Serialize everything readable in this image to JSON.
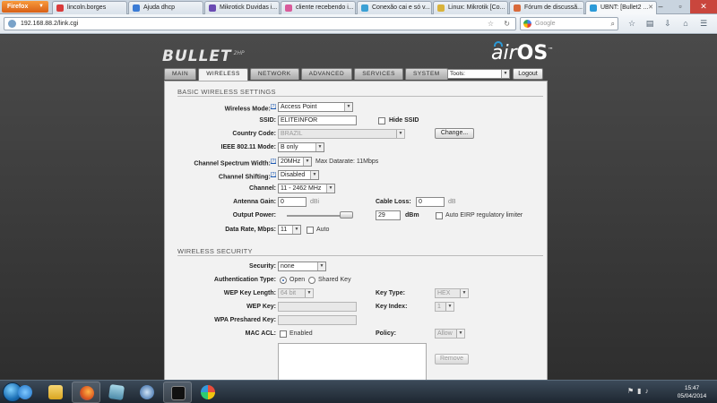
{
  "browser": {
    "menu_button": "Firefox",
    "tabs": [
      {
        "title": "lincoln.borges",
        "favicon_color": "#d93b3b"
      },
      {
        "title": "Ajuda dhcp",
        "favicon_color": "#3a7bd5"
      },
      {
        "title": "Mikrotick Duvidas i...",
        "favicon_color": "#6a4bb3"
      },
      {
        "title": "cliente recebendo i...",
        "favicon_color": "#d95b9b"
      },
      {
        "title": "Conexão cai e só v...",
        "favicon_color": "#3aa0d5"
      },
      {
        "title": "Linux: Mikrotik [Co...",
        "favicon_color": "#d9b33b"
      },
      {
        "title": "Fórum de discussã...",
        "favicon_color": "#d96a3b"
      },
      {
        "title": "UBNT: [Bullet2 ...",
        "favicon_color": "#2b9ad8"
      }
    ],
    "url": "192.168.88.2/link.cgi",
    "search_placeholder": "Google"
  },
  "header": {
    "product_logo": "BULLET",
    "product_logo_sub": "2HP",
    "brand_air": "air",
    "brand_os": "OS",
    "brand_tm": "™",
    "tabs": [
      "MAIN",
      "WIRELESS",
      "NETWORK",
      "ADVANCED",
      "SERVICES",
      "SYSTEM"
    ],
    "tools_label": "Tools:",
    "logout_label": "Logout"
  },
  "basic": {
    "title": "BASIC WIRELESS SETTINGS",
    "wireless_mode_label": "Wireless Mode:",
    "wireless_mode_value": "Access Point",
    "ssid_label": "SSID:",
    "ssid_value": "ELITEINFOR",
    "hide_ssid_label": "Hide SSID",
    "country_label": "Country Code:",
    "country_value": "BRAZIL",
    "change_label": "Change...",
    "ieee_label": "IEEE 802.11 Mode:",
    "ieee_value": "B only",
    "width_label": "Channel Spectrum Width:",
    "width_value": "20MHz",
    "max_datarate": "Max Datarate: 11Mbps",
    "shifting_label": "Channel Shifting:",
    "shifting_value": "Disabled",
    "channel_label": "Channel:",
    "channel_value": "11 - 2462 MHz",
    "antenna_gain_label": "Antenna Gain:",
    "antenna_gain_value": "0",
    "antenna_gain_unit": "dBi",
    "cable_loss_label": "Cable Loss:",
    "cable_loss_value": "0",
    "cable_loss_unit": "dB",
    "output_power_label": "Output Power:",
    "output_power_value": "29",
    "output_power_unit": "dBm",
    "output_power_fraction": 1.0,
    "auto_eirp_label": "Auto EIRP regulatory limiter",
    "data_rate_label": "Data Rate, Mbps:",
    "data_rate_value": "11",
    "data_rate_auto": "Auto",
    "help_mark": "[?]"
  },
  "security": {
    "title": "WIRELESS SECURITY",
    "security_label": "Security:",
    "security_value": "none",
    "auth_label": "Authentication Type:",
    "auth_open": "Open",
    "auth_shared": "Shared Key",
    "wep_len_label": "WEP Key Length:",
    "wep_len_value": "64 bit",
    "key_type_label": "Key Type:",
    "key_type_value": "HEX",
    "wep_key_label": "WEP Key:",
    "key_index_label": "Key Index:",
    "key_index_value": "1",
    "wpa_label": "WPA Preshared Key:",
    "mac_acl_label": "MAC ACL:",
    "mac_acl_enabled": "Enabled",
    "policy_label": "Policy:",
    "policy_value": "Allow",
    "remove_label": "Remove"
  },
  "taskbar": {
    "time": "15:47",
    "date": "05/04/2014"
  }
}
